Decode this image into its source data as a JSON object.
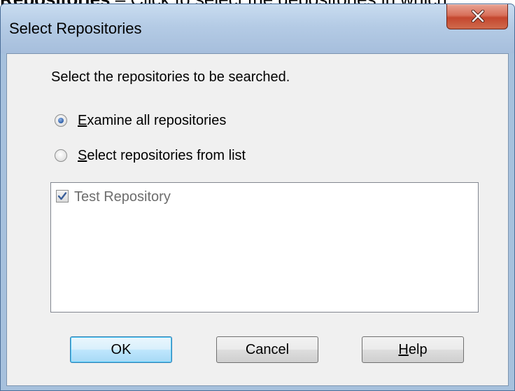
{
  "document": {
    "heading_bold": "Repositories",
    "heading_rest": " – Click to select the depositories in which"
  },
  "dialog": {
    "title": "Select Repositories",
    "instruction": "Select the repositories to be searched.",
    "options": [
      {
        "label_mnemonic": "E",
        "label_rest": "xamine all repositories",
        "checked": true
      },
      {
        "label_mnemonic": "S",
        "label_rest": "elect repositories from list",
        "checked": false
      }
    ],
    "repositories": [
      {
        "label": "Test Repository",
        "checked": true,
        "enabled": false
      }
    ],
    "buttons": {
      "ok": "OK",
      "cancel": "Cancel",
      "help_mnemonic": "H",
      "help_rest": "elp"
    }
  },
  "colors": {
    "title_bar": "#b4cbe5",
    "close_button": "#c4472f",
    "client_bg": "#f0f0f0",
    "radio_selected": "#2f5fa8",
    "disabled_text": "#6d6d6d",
    "default_button_border": "#3c7fb1"
  },
  "icons": {
    "close": "close-x-icon",
    "check": "checkmark-icon"
  }
}
